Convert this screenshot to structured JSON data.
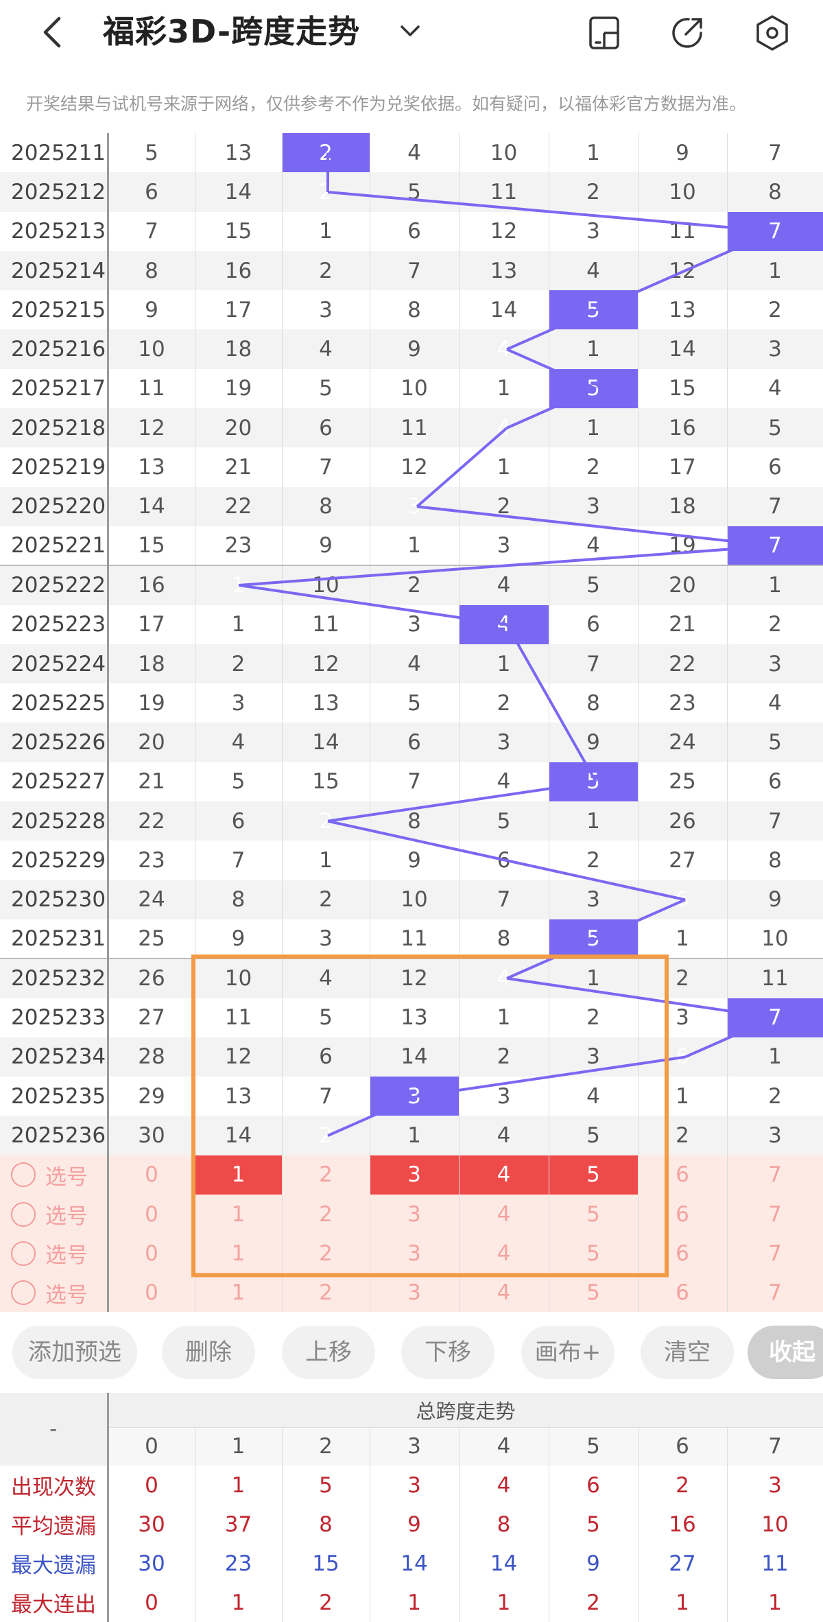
{
  "header": {
    "title": "福彩3D-跨度走势",
    "notice": "开奖结果与试机号来源于网络，仅供参考不作为兑奖依据。如有疑问，以福体彩官方数据为准。"
  },
  "colors": {
    "hit": "#7a68f2",
    "line": "#7a68f2",
    "select_red": "#ef4a4a",
    "box": "#f39a44"
  },
  "rows": [
    {
      "period": "2025211",
      "vals": [
        "5",
        "13",
        "2",
        "4",
        "10",
        "1",
        "9",
        "7"
      ],
      "hit": 2
    },
    {
      "period": "2025212",
      "vals": [
        "6",
        "14",
        "2",
        "5",
        "11",
        "2",
        "10",
        "8"
      ],
      "hit": 2
    },
    {
      "period": "2025213",
      "vals": [
        "7",
        "15",
        "1",
        "6",
        "12",
        "3",
        "11",
        "7"
      ],
      "hit": 7
    },
    {
      "period": "2025214",
      "vals": [
        "8",
        "16",
        "2",
        "7",
        "13",
        "4",
        "12",
        "1"
      ],
      "hit": -1
    },
    {
      "period": "2025215",
      "vals": [
        "9",
        "17",
        "3",
        "8",
        "14",
        "5",
        "13",
        "2"
      ],
      "hit": 5
    },
    {
      "period": "2025216",
      "vals": [
        "10",
        "18",
        "4",
        "9",
        "4",
        "1",
        "14",
        "3"
      ],
      "hit": 4
    },
    {
      "period": "2025217",
      "vals": [
        "11",
        "19",
        "5",
        "10",
        "1",
        "5",
        "15",
        "4"
      ],
      "hit": 5
    },
    {
      "period": "2025218",
      "vals": [
        "12",
        "20",
        "6",
        "11",
        "4",
        "1",
        "16",
        "5"
      ],
      "hit": 4
    },
    {
      "period": "2025219",
      "vals": [
        "13",
        "21",
        "7",
        "12",
        "1",
        "2",
        "17",
        "6"
      ],
      "hit": -1
    },
    {
      "period": "2025220",
      "vals": [
        "14",
        "22",
        "8",
        "3",
        "2",
        "3",
        "18",
        "7"
      ],
      "hit": 3
    },
    {
      "period": "2025221",
      "vals": [
        "15",
        "23",
        "9",
        "1",
        "3",
        "4",
        "19",
        "7"
      ],
      "hit": 7
    },
    {
      "period": "2025222",
      "vals": [
        "16",
        "1",
        "10",
        "2",
        "4",
        "5",
        "20",
        "1"
      ],
      "hit": 1
    },
    {
      "period": "2025223",
      "vals": [
        "17",
        "1",
        "11",
        "3",
        "4",
        "6",
        "21",
        "2"
      ],
      "hit": 4
    },
    {
      "period": "2025224",
      "vals": [
        "18",
        "2",
        "12",
        "4",
        "1",
        "7",
        "22",
        "3"
      ],
      "hit": -1
    },
    {
      "period": "2025225",
      "vals": [
        "19",
        "3",
        "13",
        "5",
        "2",
        "8",
        "23",
        "4"
      ],
      "hit": -1
    },
    {
      "period": "2025226",
      "vals": [
        "20",
        "4",
        "14",
        "6",
        "3",
        "9",
        "24",
        "5"
      ],
      "hit": -1
    },
    {
      "period": "2025227",
      "vals": [
        "21",
        "5",
        "15",
        "7",
        "4",
        "5",
        "25",
        "6"
      ],
      "hit": 5
    },
    {
      "period": "2025228",
      "vals": [
        "22",
        "6",
        "2",
        "8",
        "5",
        "1",
        "26",
        "7"
      ],
      "hit": 2
    },
    {
      "period": "2025229",
      "vals": [
        "23",
        "7",
        "1",
        "9",
        "6",
        "2",
        "27",
        "8"
      ],
      "hit": -1
    },
    {
      "period": "2025230",
      "vals": [
        "24",
        "8",
        "2",
        "10",
        "7",
        "3",
        "6",
        "9"
      ],
      "hit": 6
    },
    {
      "period": "2025231",
      "vals": [
        "25",
        "9",
        "3",
        "11",
        "8",
        "5",
        "1",
        "10"
      ],
      "hit": 5
    },
    {
      "period": "2025232",
      "vals": [
        "26",
        "10",
        "4",
        "12",
        "4",
        "1",
        "2",
        "11"
      ],
      "hit": 4
    },
    {
      "period": "2025233",
      "vals": [
        "27",
        "11",
        "5",
        "13",
        "1",
        "2",
        "3",
        "7"
      ],
      "hit": 7
    },
    {
      "period": "2025234",
      "vals": [
        "28",
        "12",
        "6",
        "14",
        "2",
        "3",
        "6",
        "1"
      ],
      "hit": 6
    },
    {
      "period": "2025235",
      "vals": [
        "29",
        "13",
        "7",
        "3",
        "3",
        "4",
        "1",
        "2"
      ],
      "hit": 3
    },
    {
      "period": "2025236",
      "vals": [
        "30",
        "14",
        "2",
        "1",
        "4",
        "5",
        "2",
        "3"
      ],
      "hit": 2
    }
  ],
  "select_rows": [
    {
      "label": "选号",
      "vals": [
        "0",
        "1",
        "2",
        "3",
        "4",
        "5",
        "6",
        "7"
      ],
      "selected": [
        1,
        3,
        4,
        5
      ]
    },
    {
      "label": "选号",
      "vals": [
        "0",
        "1",
        "2",
        "3",
        "4",
        "5",
        "6",
        "7"
      ],
      "selected": []
    },
    {
      "label": "选号",
      "vals": [
        "0",
        "1",
        "2",
        "3",
        "4",
        "5",
        "6",
        "7"
      ],
      "selected": []
    },
    {
      "label": "选号",
      "vals": [
        "0",
        "1",
        "2",
        "3",
        "4",
        "5",
        "6",
        "7"
      ],
      "selected": []
    }
  ],
  "toolbar": {
    "add_preselect": "添加预选",
    "delete": "删除",
    "move_up": "上移",
    "move_down": "下移",
    "canvas": "画布+",
    "clear": "清空",
    "collapse": "收起"
  },
  "stats": {
    "corner": "-",
    "title": "总跨度走势",
    "cols": [
      "0",
      "1",
      "2",
      "3",
      "4",
      "5",
      "6",
      "7"
    ],
    "rows": [
      {
        "label": "出现次数",
        "vals": [
          "0",
          "1",
          "5",
          "3",
          "4",
          "6",
          "2",
          "3"
        ],
        "style": "red"
      },
      {
        "label": "平均遗漏",
        "vals": [
          "30",
          "37",
          "8",
          "9",
          "8",
          "5",
          "16",
          "10"
        ],
        "style": "red"
      },
      {
        "label": "最大遗漏",
        "vals": [
          "30",
          "23",
          "15",
          "14",
          "14",
          "9",
          "27",
          "11"
        ],
        "style": "blue"
      },
      {
        "label": "最大连出",
        "vals": [
          "0",
          "1",
          "2",
          "1",
          "1",
          "2",
          "1",
          "1"
        ],
        "style": "red"
      }
    ]
  }
}
